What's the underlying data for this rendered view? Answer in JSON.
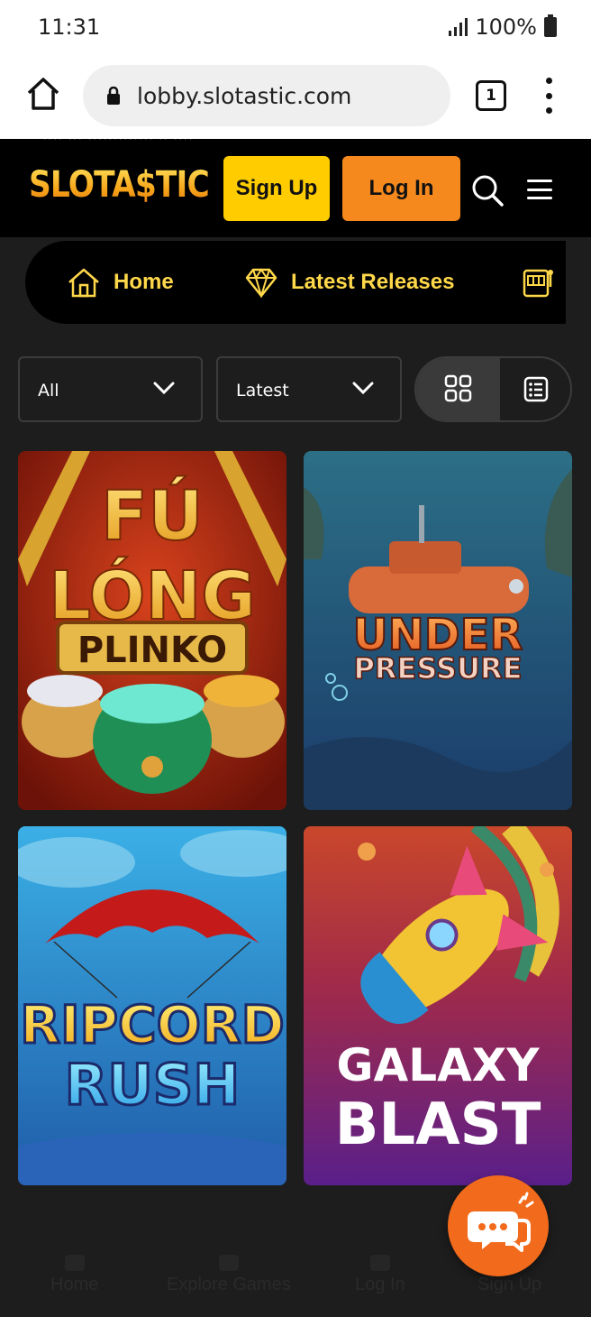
{
  "status_bar": {
    "time": "11:31",
    "battery": "100%"
  },
  "browser": {
    "url": "lobby.slotastic.com",
    "tab_count": "1"
  },
  "header": {
    "ticker": "···· ··· ············· ·· ····",
    "logo": "SLOTA$TIC",
    "signup_label": "Sign Up",
    "login_label": "Log In"
  },
  "categories": [
    {
      "label": "Home",
      "icon": "home-icon"
    },
    {
      "label": "Latest Releases",
      "icon": "diamond-icon"
    },
    {
      "label": "",
      "icon": "slot-machine-icon"
    }
  ],
  "filters": {
    "type_value": "All",
    "sort_value": "Latest",
    "view": "grid"
  },
  "games": [
    {
      "title_line1": "FÚ",
      "title_line2": "LÓNG",
      "title_line3": "PLINKO"
    },
    {
      "title_line1": "UNDER",
      "title_line2": "PRESSURE"
    },
    {
      "title_line1": "RIPCORD",
      "title_line2": "RUSH"
    },
    {
      "title_line1": "GALAXY",
      "title_line2": "BLAST"
    }
  ],
  "bottom_nav": [
    {
      "label": "Home"
    },
    {
      "label": "Explore Games"
    },
    {
      "label": "Log In"
    },
    {
      "label": "Sign Up"
    }
  ],
  "colors": {
    "accent_yellow": "#ffcc00",
    "accent_orange": "#f5891e",
    "nav_text": "#ffd84a",
    "chat_fab": "#f26a1b"
  }
}
